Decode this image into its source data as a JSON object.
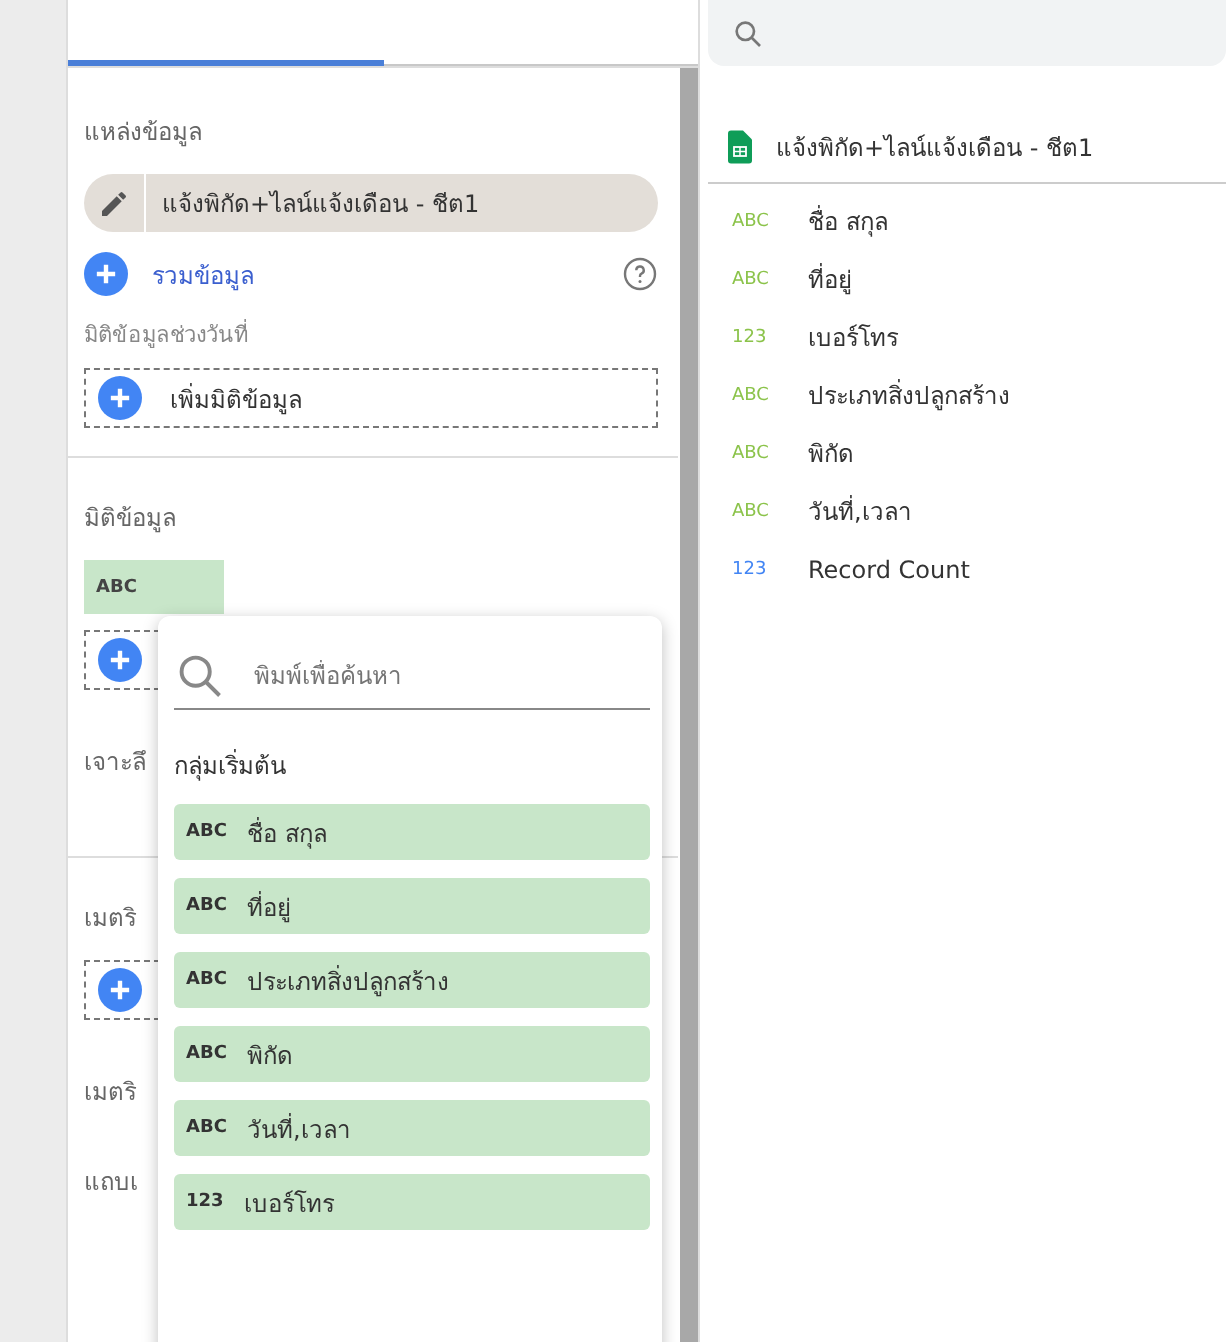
{
  "tabs": [
    {
      "selected": true
    },
    {
      "selected": false
    }
  ],
  "left_panel": {
    "data_source_heading": "แหล่งข้อมูล",
    "data_source": "แจ้งพิกัด+ไลน์แจ้งเดือน - ชีต1",
    "blend_link": "รวมข้อมูล",
    "date_range_heading": "มิติข้อมูลช่วงวันที่",
    "add_dimension": "เพิ่มมิติข้อมูล",
    "dimension_heading": "มิติข้อมูล",
    "dimension_chip_type": "ABC",
    "drill_down_label": "เจาะลึ",
    "metric_heading": "เมตริ",
    "optional_metric_label": "เมตริ",
    "slider_label": "แถบเ"
  },
  "popup": {
    "search": {
      "placeholder": "พิมพ์เพื่อค้นหา"
    },
    "group_heading": "กลุ่มเริ่มต้น",
    "fields": [
      {
        "type": "ABC",
        "name": "ชื่อ สกุล"
      },
      {
        "type": "ABC",
        "name": "ที่อยู่"
      },
      {
        "type": "ABC",
        "name": "ประเภทสิ่งปลูกสร้าง"
      },
      {
        "type": "ABC",
        "name": "พิกัด"
      },
      {
        "type": "ABC",
        "name": "วันที่,เวลา"
      },
      {
        "type": "123",
        "name": "เบอร์โทร"
      }
    ]
  },
  "right_panel": {
    "source_name": "แจ้งพิกัด+ไลน์แจ้งเดือน - ชีต1",
    "fields": [
      {
        "type": "ABC",
        "name": "ชื่อ สกุล",
        "color": "#8bc34a"
      },
      {
        "type": "ABC",
        "name": "ที่อยู่",
        "color": "#8bc34a"
      },
      {
        "type": "123",
        "name": "เบอร์โทร",
        "color": "#8bc34a"
      },
      {
        "type": "ABC",
        "name": "ประเภทสิ่งปลูกสร้าง",
        "color": "#8bc34a"
      },
      {
        "type": "ABC",
        "name": "พิกัด",
        "color": "#8bc34a"
      },
      {
        "type": "ABC",
        "name": "วันที่,เวลา",
        "color": "#8bc34a"
      },
      {
        "type": "123",
        "name": "Record Count",
        "color": "#4285f4"
      }
    ]
  }
}
